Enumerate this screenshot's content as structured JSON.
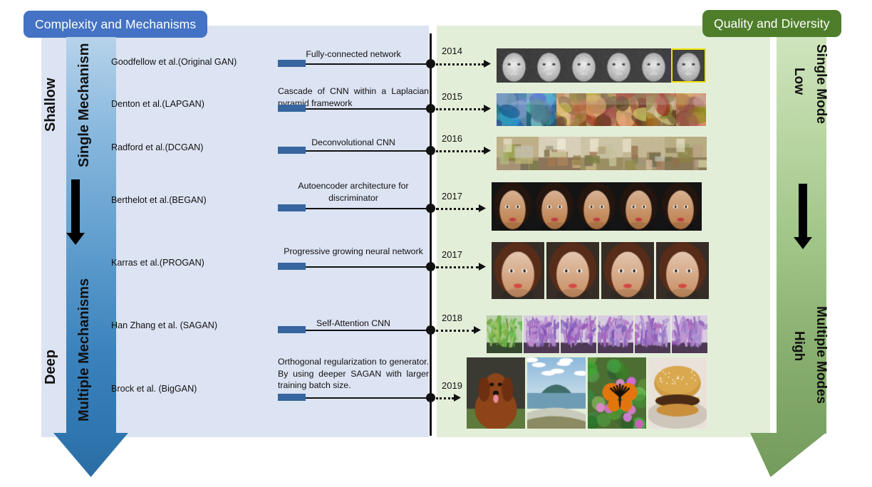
{
  "header": {
    "left_pill": "Complexity and Mechanisms",
    "right_pill": "Quality and Diversity"
  },
  "left_axis": {
    "name": "complexity-axis",
    "top_label": "Shallow",
    "bottom_label": "Deep",
    "top_group": "Single Mechanism",
    "bottom_group": "Multiple Mechanisms",
    "color_top": "#b6d3ea",
    "color_bottom": "#2f76b0",
    "arrow_direction": "down"
  },
  "right_axis": {
    "name": "quality-axis",
    "top_label": "Low",
    "bottom_label": "High",
    "top_group": "Single Mode",
    "bottom_group": "Multiple Modes",
    "color_top": "#cfe4be",
    "color_bottom": "#7ba263",
    "arrow_direction": "down"
  },
  "colors": {
    "left_panel": "#dce3f2",
    "right_panel": "#e3eed9",
    "left_pill": "#4472c4",
    "right_pill": "#4f7e2a",
    "bar": "#36659f",
    "timeline": "#111111",
    "highlight_border": "#f2e400"
  },
  "timeline_rows": [
    {
      "author": "Goodfellow et al.(Original GAN)",
      "description": "Fully-connected network",
      "year": "2014",
      "justify": false,
      "samples": "mnist-faces-grayscale",
      "sample_count": 6,
      "highlight_last": true
    },
    {
      "author": "Denton et al.(LAPGAN)",
      "description": "Cascade of CNN within a Laplacian pyramid framework",
      "year": "2015",
      "justify": true,
      "samples": "lapgan-lowres-scenes",
      "sample_count": 7,
      "highlight_last": false
    },
    {
      "author": "Radford et al.(DCGAN)",
      "description": "Deconvolutional CNN",
      "year": "2016",
      "justify": false,
      "samples": "dcgan-bedrooms",
      "sample_count": 5,
      "highlight_last": false
    },
    {
      "author": "Berthelot et al.(BEGAN)",
      "description": "Autoencoder architecture for discriminator",
      "year": "2017",
      "justify": false,
      "samples": "began-faces",
      "sample_count": 5,
      "highlight_last": false
    },
    {
      "author": "Karras et al.(PROGAN)",
      "description": "Progressive growing neural network",
      "year": "2017",
      "justify": false,
      "samples": "progan-celeba-hq-faces",
      "sample_count": 4,
      "highlight_last": false
    },
    {
      "author": "Han Zhang et al. (SAGAN)",
      "description": "Self-Attention CNN",
      "year": "2018",
      "justify": false,
      "samples": "sagan-coral-flowers",
      "sample_count": 6,
      "highlight_last": false
    },
    {
      "author": "Brock et al. (BigGAN)",
      "description": "Orthogonal regularization to generator. By using deeper SAGAN with larger training batch size.",
      "year": "2019",
      "justify": true,
      "samples": "biggan-dog-island-butterfly-burger",
      "sample_count": 4,
      "highlight_last": false
    }
  ]
}
